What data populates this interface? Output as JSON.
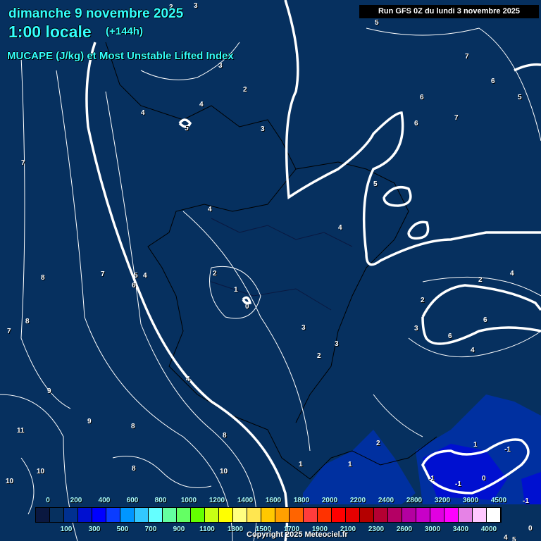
{
  "header": {
    "date": "dimanche 9 novembre 2025",
    "time": "1:00 locale",
    "lead": "(+144h)",
    "title": "MUCAPE (J/kg) et Most Unstable Lifted Index",
    "run": "Run GFS 0Z du lundi 3 novembre 2025"
  },
  "legend": {
    "top_labels": [
      "0",
      "200",
      "400",
      "600",
      "800",
      "1000",
      "1200",
      "1400",
      "1600",
      "1800",
      "2000",
      "2200",
      "2400",
      "2800",
      "3200",
      "3600",
      "4500"
    ],
    "bottom_labels": [
      "100",
      "300",
      "500",
      "700",
      "900",
      "1100",
      "1300",
      "1500",
      "1700",
      "1900",
      "2100",
      "2300",
      "2600",
      "3000",
      "3400",
      "4000"
    ],
    "colors": [
      "#0a1840",
      "#06305f",
      "#003090",
      "#0010d0",
      "#0000ff",
      "#0a3cff",
      "#0096ff",
      "#32c8ff",
      "#64ffff",
      "#64ffa0",
      "#64ff64",
      "#64ff00",
      "#c8ff14",
      "#ffff00",
      "#ffff80",
      "#ffe650",
      "#ffc800",
      "#ffa000",
      "#ff6400",
      "#ff3c3c",
      "#ff3200",
      "#ff0000",
      "#e60000",
      "#b40000",
      "#b40032",
      "#b40064",
      "#b400a0",
      "#c800c8",
      "#e100e1",
      "#ff00ff",
      "#e682e6",
      "#ffc8ff",
      "#ffffff"
    ]
  },
  "contour_labels": [
    "2",
    "3",
    "3",
    "4",
    "5",
    "4",
    "3",
    "2",
    "7",
    "6",
    "6",
    "7",
    "7",
    "6",
    "5",
    "5",
    "5",
    "4",
    "4",
    "2",
    "1",
    "0",
    "8",
    "7",
    "5",
    "4",
    "6",
    "8",
    "7",
    "3",
    "2",
    "3",
    "4",
    "2",
    "2",
    "3",
    "6",
    "6",
    "4",
    "4",
    "9",
    "9",
    "8",
    "8",
    "10",
    "8",
    "11",
    "10",
    "10",
    "1",
    "2",
    "1",
    "1",
    "-1",
    "0",
    "-1",
    "-1",
    "4",
    "5",
    "-1",
    "0"
  ],
  "copyright": "Copyright 2025 Meteociel.fr",
  "colors": {
    "background": "#06305f",
    "title": "#33ffff",
    "unstable": "#0010d0"
  }
}
